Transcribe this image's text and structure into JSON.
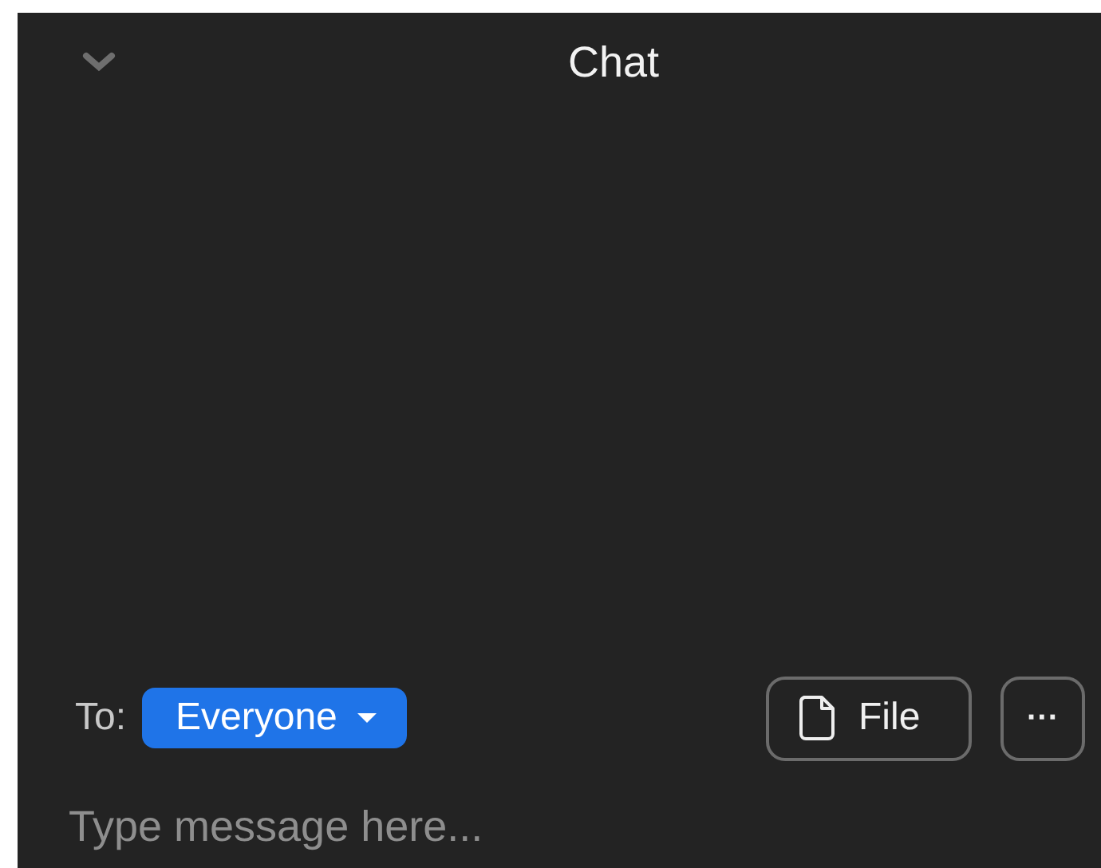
{
  "header": {
    "title": "Chat"
  },
  "recipient": {
    "label": "To:",
    "value": "Everyone"
  },
  "actions": {
    "file_button": "File",
    "more_button": "···"
  },
  "composer": {
    "placeholder": "Type message here..."
  }
}
